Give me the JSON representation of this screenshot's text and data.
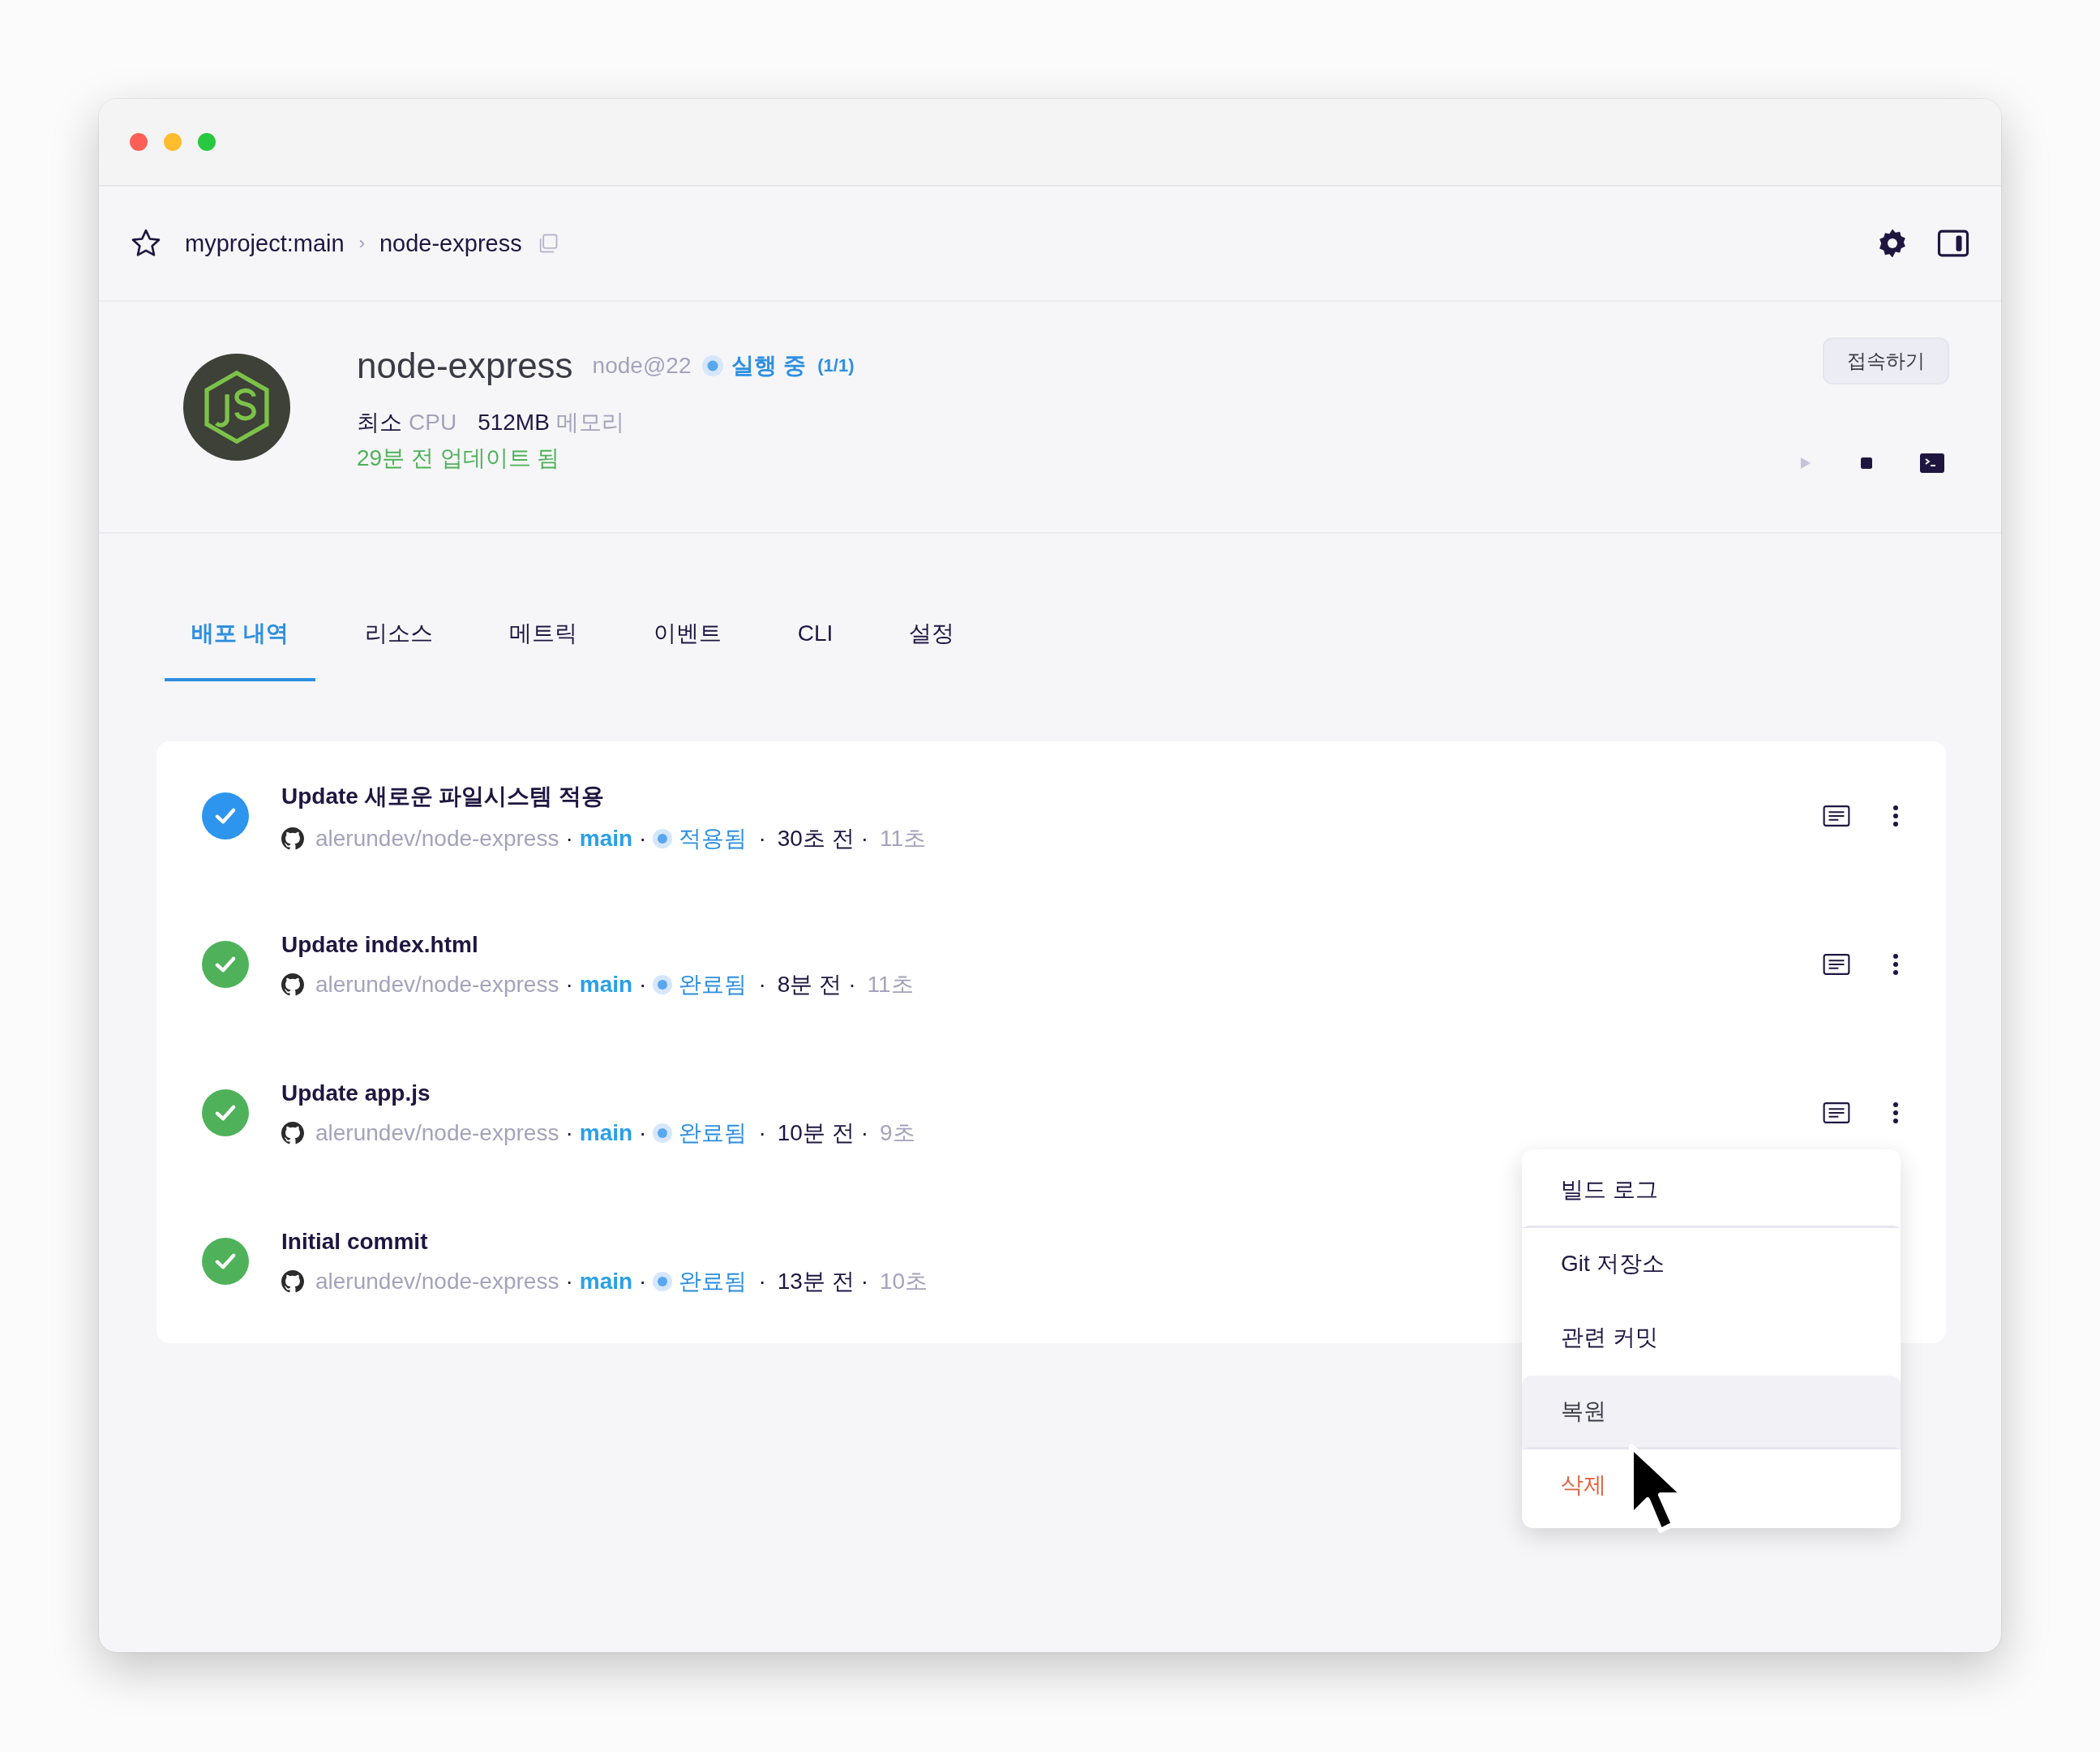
{
  "breadcrumb": {
    "project": "myproject:main",
    "separator": "›",
    "service": "node-express"
  },
  "service": {
    "name": "node-express",
    "runtime": "node@22",
    "status_label": "실행 중",
    "status_count": "(1/1)",
    "cpu_value": "최소",
    "cpu_label": "CPU",
    "memory_value": "512MB",
    "memory_label": "메모리",
    "updated": "29분 전 업데이트 됨",
    "connect_button": "접속하기"
  },
  "tabs": [
    {
      "label": "배포 내역",
      "selected": true
    },
    {
      "label": "리소스",
      "selected": false
    },
    {
      "label": "메트릭",
      "selected": false
    },
    {
      "label": "이벤트",
      "selected": false
    },
    {
      "label": "CLI",
      "selected": false
    },
    {
      "label": "설정",
      "selected": false
    }
  ],
  "deployments": {
    "separator": "·",
    "items": [
      {
        "title": "Update 새로운 파일시스템 적용",
        "repo": "alerundev/node-express",
        "branch": "main",
        "kind": "applied",
        "status": "적용됨",
        "time": "30초 전",
        "duration": "11초",
        "actions_shown": true
      },
      {
        "title": "Update index.html",
        "repo": "alerundev/node-express",
        "branch": "main",
        "kind": "done",
        "status": "완료됨",
        "time": "8분 전",
        "duration": "11초",
        "actions_shown": true
      },
      {
        "title": "Update app.js",
        "repo": "alerundev/node-express",
        "branch": "main",
        "kind": "done",
        "status": "완료됨",
        "time": "10분 전",
        "duration": "9초",
        "actions_shown": true
      },
      {
        "title": "Initial commit",
        "repo": "alerundev/node-express",
        "branch": "main",
        "kind": "done",
        "status": "완료됨",
        "time": "13분 전",
        "duration": "10초",
        "actions_shown": false
      }
    ]
  },
  "context_menu": {
    "items": [
      {
        "label": "빌드 로그",
        "kind": "normal",
        "selected": false,
        "divider_after": true
      },
      {
        "label": "Git 저장소",
        "kind": "normal",
        "selected": false,
        "divider_after": false
      },
      {
        "label": "관련 커밋",
        "kind": "normal",
        "selected": false,
        "divider_after": false
      },
      {
        "label": "복원",
        "kind": "normal",
        "selected": true,
        "divider_after": true
      },
      {
        "label": "삭제",
        "kind": "danger",
        "selected": false,
        "divider_after": false
      }
    ]
  }
}
